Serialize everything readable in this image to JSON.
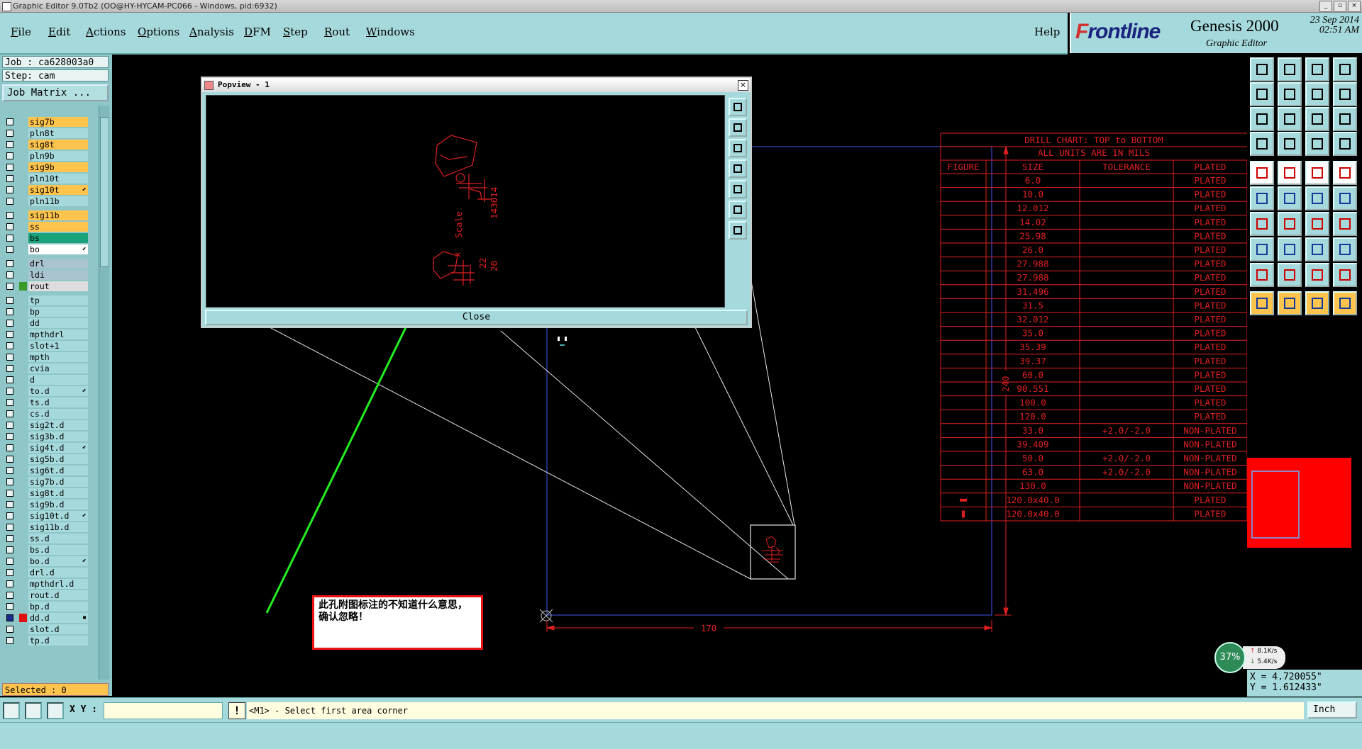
{
  "window": {
    "title": "Graphic Editor 9.0Tb2 (OO@HY-HYCAM-PC066 - Windows, pid:6932)",
    "min_label": "_",
    "max_label": "▫",
    "close_label": "×"
  },
  "menu": {
    "items": [
      {
        "label": "File",
        "u": "F",
        "rest": "ile"
      },
      {
        "label": "Edit",
        "u": "E",
        "rest": "dit"
      },
      {
        "label": "Actions",
        "u": "A",
        "rest": "ctions"
      },
      {
        "label": "Options",
        "u": "O",
        "rest": "ptions"
      },
      {
        "label": "Analysis",
        "u": "A",
        "rest": "nalysis"
      },
      {
        "label": "DFM",
        "u": "D",
        "rest": "FM"
      },
      {
        "label": "Step",
        "u": "S",
        "rest": "tep"
      },
      {
        "label": "Rout",
        "u": "R",
        "rest": "out"
      },
      {
        "label": "Windows",
        "u": "W",
        "rest": "indows"
      }
    ],
    "help": "Help"
  },
  "brand": {
    "logo_f": "F",
    "logo_rest": "rontline",
    "product": "Genesis 2000",
    "subtitle": "Graphic Editor",
    "date": "23 Sep 2014",
    "time": "02:51 AM"
  },
  "job": {
    "job_label": "Job : ca628003a0",
    "step_label": "Step: cam",
    "matrix_button": "Job Matrix ..."
  },
  "layers": [
    {
      "name": "sig7b",
      "color": "#ffc44d",
      "gap": 0
    },
    {
      "name": "pln8t",
      "color": "#a6d9dc",
      "gap": 0
    },
    {
      "name": "sig8t",
      "color": "#ffc44d",
      "gap": 0
    },
    {
      "name": "pln9b",
      "color": "#a6d9dc",
      "gap": 0
    },
    {
      "name": "sig9b",
      "color": "#ffc44d",
      "gap": 0
    },
    {
      "name": "pln10t",
      "color": "#a6d9dc",
      "gap": 0
    },
    {
      "name": "sig10t",
      "color": "#ffc44d",
      "gap": 0,
      "flag": "⬋"
    },
    {
      "name": "pln11b",
      "color": "#a6d9dc",
      "gap": 0
    },
    {
      "name": "sig11b",
      "color": "#ffc44d",
      "gap": 4
    },
    {
      "name": "ss",
      "color": "#ffc44d",
      "gap": 0
    },
    {
      "name": "bs",
      "color": "#1aa37a",
      "gap": 0
    },
    {
      "name": "bo",
      "color": "#ffffff",
      "gap": 0,
      "flag": "⬋"
    },
    {
      "name": "drl",
      "color": "#a9c4cf",
      "gap": 4
    },
    {
      "name": "ldi",
      "color": "#a9c4cf",
      "gap": 0
    },
    {
      "name": "rout",
      "color": "#dddddd",
      "gap": 0,
      "swatch": "#3a9a2a"
    },
    {
      "name": "tp",
      "color": "#a6d9dc",
      "gap": 4
    },
    {
      "name": "bp",
      "color": "#a6d9dc",
      "gap": 0
    },
    {
      "name": "dd",
      "color": "#a6d9dc",
      "gap": 0
    },
    {
      "name": "mpthdrl",
      "color": "#a6d9dc",
      "gap": 0
    },
    {
      "name": "slot+1",
      "color": "#a6d9dc",
      "gap": 0
    },
    {
      "name": "mpth",
      "color": "#a6d9dc",
      "gap": 0
    },
    {
      "name": "cvia",
      "color": "#a6d9dc",
      "gap": 0
    },
    {
      "name": "d",
      "color": "#a6d9dc",
      "gap": 0
    },
    {
      "name": "to.d",
      "color": "#a6d9dc",
      "gap": 0,
      "flag": "⬋"
    },
    {
      "name": "ts.d",
      "color": "#a6d9dc",
      "gap": 0
    },
    {
      "name": "cs.d",
      "color": "#a6d9dc",
      "gap": 0
    },
    {
      "name": "sig2t.d",
      "color": "#a6d9dc",
      "gap": 0
    },
    {
      "name": "sig3b.d",
      "color": "#a6d9dc",
      "gap": 0
    },
    {
      "name": "sig4t.d",
      "color": "#a6d9dc",
      "gap": 0,
      "flag": "⬋"
    },
    {
      "name": "sig5b.d",
      "color": "#a6d9dc",
      "gap": 0
    },
    {
      "name": "sig6t.d",
      "color": "#a6d9dc",
      "gap": 0
    },
    {
      "name": "sig7b.d",
      "color": "#a6d9dc",
      "gap": 0
    },
    {
      "name": "sig8t.d",
      "color": "#a6d9dc",
      "gap": 0
    },
    {
      "name": "sig9b.d",
      "color": "#a6d9dc",
      "gap": 0
    },
    {
      "name": "sig10t.d",
      "color": "#a6d9dc",
      "gap": 0,
      "flag": "⬋"
    },
    {
      "name": "sig11b.d",
      "color": "#a6d9dc",
      "gap": 0
    },
    {
      "name": "ss.d",
      "color": "#a6d9dc",
      "gap": 0
    },
    {
      "name": "bs.d",
      "color": "#a6d9dc",
      "gap": 0
    },
    {
      "name": "bo.d",
      "color": "#a6d9dc",
      "gap": 0,
      "flag": "⬋"
    },
    {
      "name": "drl.d",
      "color": "#a6d9dc",
      "gap": 0
    },
    {
      "name": "mpthdrl.d",
      "color": "#a6d9dc",
      "gap": 0
    },
    {
      "name": "rout.d",
      "color": "#a6d9dc",
      "gap": 0
    },
    {
      "name": "bp.d",
      "color": "#a6d9dc",
      "gap": 0
    },
    {
      "name": "dd.d",
      "color": "#a6d9dc",
      "gap": 0,
      "swatch": "#e01010",
      "flag": "▪",
      "active": true
    },
    {
      "name": "slot.d",
      "color": "#a6d9dc",
      "gap": 0
    },
    {
      "name": "tp.d",
      "color": "#a6d9dc",
      "gap": 0
    }
  ],
  "selected_label": "Selected : 0",
  "popview": {
    "title": "Popview - 1",
    "close_button": "Close",
    "close_x": "×"
  },
  "drill_chart": {
    "title": "DRILL CHART: TOP to BOTTOM",
    "units": "ALL UNITS ARE IN MILS",
    "headers": [
      "FIGURE",
      "SIZE",
      "TOLERANCE",
      "PLATED"
    ],
    "rows": [
      {
        "figure": "",
        "size": "6.0",
        "tol": "",
        "plated": "PLATED"
      },
      {
        "figure": "",
        "size": "10.0",
        "tol": "",
        "plated": "PLATED"
      },
      {
        "figure": "",
        "size": "12.012",
        "tol": "",
        "plated": "PLATED"
      },
      {
        "figure": "",
        "size": "14.02",
        "tol": "",
        "plated": "PLATED"
      },
      {
        "figure": "",
        "size": "25.98",
        "tol": "",
        "plated": "PLATED"
      },
      {
        "figure": "",
        "size": "26.0",
        "tol": "",
        "plated": "PLATED"
      },
      {
        "figure": "",
        "size": "27.988",
        "tol": "",
        "plated": "PLATED"
      },
      {
        "figure": "",
        "size": "27.988",
        "tol": "",
        "plated": "PLATED"
      },
      {
        "figure": "",
        "size": "31.496",
        "tol": "",
        "plated": "PLATED"
      },
      {
        "figure": "",
        "size": "31.5",
        "tol": "",
        "plated": "PLATED"
      },
      {
        "figure": "",
        "size": "32.012",
        "tol": "",
        "plated": "PLATED"
      },
      {
        "figure": "",
        "size": "35.0",
        "tol": "",
        "plated": "PLATED"
      },
      {
        "figure": "",
        "size": "35.39",
        "tol": "",
        "plated": "PLATED"
      },
      {
        "figure": "",
        "size": "39.37",
        "tol": "",
        "plated": "PLATED"
      },
      {
        "figure": "",
        "size": "60.0",
        "tol": "",
        "plated": "PLATED"
      },
      {
        "figure": "",
        "size": "90.551",
        "tol": "",
        "plated": "PLATED"
      },
      {
        "figure": "",
        "size": "100.0",
        "tol": "",
        "plated": "PLATED"
      },
      {
        "figure": "",
        "size": "120.0",
        "tol": "",
        "plated": "PLATED"
      },
      {
        "figure": "",
        "size": "33.0",
        "tol": "+2.0/-2.0",
        "plated": "NON-PLATED"
      },
      {
        "figure": "",
        "size": "39.409",
        "tol": "",
        "plated": "NON-PLATED"
      },
      {
        "figure": "",
        "size": "50.0",
        "tol": "+2.0/-2.0",
        "plated": "NON-PLATED"
      },
      {
        "figure": "",
        "size": "63.0",
        "tol": "+2.0/-2.0",
        "plated": "NON-PLATED"
      },
      {
        "figure": "",
        "size": "130.0",
        "tol": "",
        "plated": "NON-PLATED"
      },
      {
        "figure": "slot-h",
        "size": "120.0x40.0",
        "tol": "",
        "plated": "PLATED"
      },
      {
        "figure": "slot-v",
        "size": "120.0x40.0",
        "tol": "",
        "plated": "PLATED"
      }
    ]
  },
  "dimensions": {
    "width_label": "170",
    "height_label": "240"
  },
  "popview_text": {
    "scale": "Scale",
    "x": "x",
    "num1": "143014",
    "num2": "20",
    "num3": "22"
  },
  "annotation_note": "此孔附图标注的不知道什么意思，确认忽略！",
  "network": {
    "percent": "37%",
    "up": "8.1K/s",
    "down": "5.4K/s",
    "up_arrow": "↑",
    "down_arrow": "↓"
  },
  "coords": {
    "x": "X = 4.720055\"",
    "y": "Y = 1.612433\""
  },
  "bottom": {
    "xy_label": "X Y :",
    "xy_value": "",
    "message_icon": "!",
    "prompt": "<M1> - Select first area corner",
    "units": "Inch"
  },
  "colors": {
    "panel": "#a6d9dc",
    "drill": "#e02020",
    "outline": "#3a48c8",
    "arrow": "#22ee22"
  }
}
